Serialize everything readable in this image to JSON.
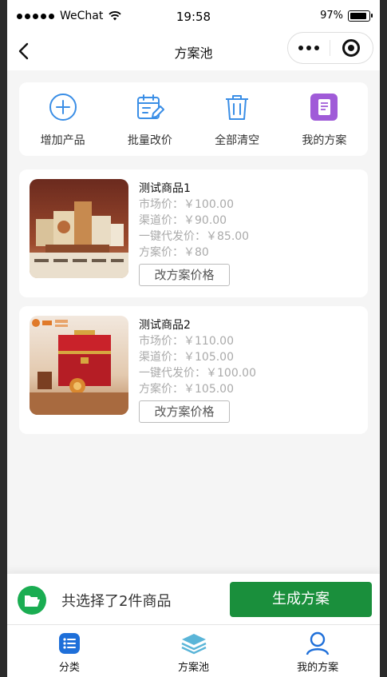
{
  "status_bar": {
    "carrier": "WeChat",
    "time": "19:58",
    "battery": "97%"
  },
  "nav": {
    "title": "方案池",
    "back_icon": "back-chevron-icon",
    "menu_icon": "more-dots-icon",
    "close_icon": "miniprogram-close-icon"
  },
  "actions": [
    {
      "label": "增加产品",
      "icon": "add-circle-icon",
      "color": "#3a8ee6"
    },
    {
      "label": "批量改价",
      "icon": "calendar-edit-icon",
      "color": "#3a8ee6"
    },
    {
      "label": "全部清空",
      "icon": "trash-icon",
      "color": "#3a8ee6"
    },
    {
      "label": "我的方案",
      "icon": "document-icon",
      "color": "#a05bd8"
    }
  ],
  "products": [
    {
      "name": "测试商品1",
      "market_label": "市场价：",
      "market_price": "￥100.00",
      "channel_label": "渠道价：",
      "channel_price": "￥90.00",
      "dropship_label": "一键代发价：",
      "dropship_price": "￥85.00",
      "plan_label": "方案价：",
      "plan_price": "￥80",
      "button": "改方案价格"
    },
    {
      "name": "测试商品2",
      "market_label": "市场价：",
      "market_price": "￥110.00",
      "channel_label": "渠道价：",
      "channel_price": "￥105.00",
      "dropship_label": "一键代发价：",
      "dropship_price": "￥100.00",
      "plan_label": "方案价：",
      "plan_price": "￥105.00",
      "button": "改方案价格"
    }
  ],
  "select_bar": {
    "text": "共选择了2件商品",
    "button": "生成方案",
    "button_color": "#1a8f3c",
    "icon": "folder-open-icon"
  },
  "tabbar": [
    {
      "label": "分类",
      "icon": "list-icon"
    },
    {
      "label": "方案池",
      "icon": "layers-icon"
    },
    {
      "label": "我的方案",
      "icon": "user-icon"
    }
  ]
}
